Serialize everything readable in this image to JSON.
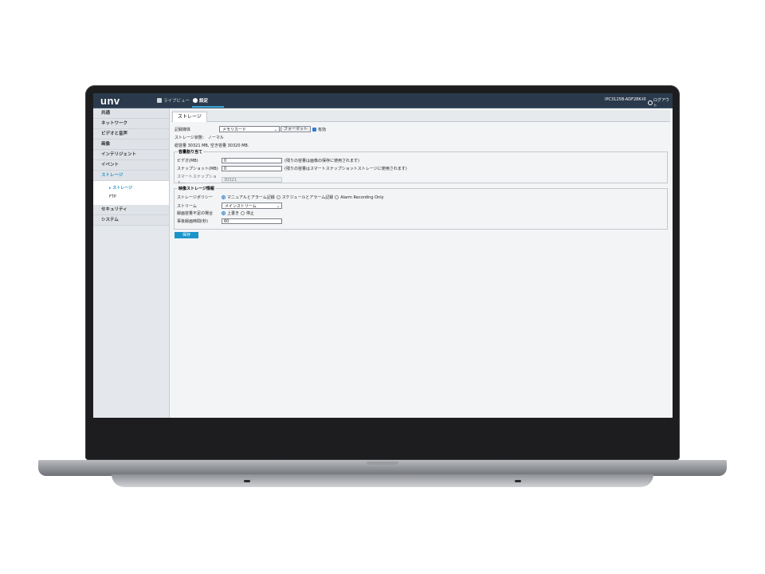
{
  "app": {
    "logo": "unv",
    "nav": [
      {
        "label": "ライブビュー",
        "icon": "camera-icon"
      },
      {
        "label": "設定",
        "icon": "gear-icon"
      }
    ],
    "device": "IPC3125B-ADF28K-I0",
    "logout": "ログアウト"
  },
  "sidebar": {
    "items": [
      {
        "label": "共通"
      },
      {
        "label": "ネットワーク"
      },
      {
        "label": "ビデオと音声"
      },
      {
        "label": "画像"
      },
      {
        "label": "インテリジェント"
      },
      {
        "label": "イベント"
      },
      {
        "label": "ストレージ"
      },
      {
        "label": "セキュリティ"
      },
      {
        "label": "システム"
      }
    ],
    "sub": [
      {
        "label": "ストレージ"
      },
      {
        "label": "FTP"
      }
    ]
  },
  "tab": "ストレージ",
  "storage": {
    "medium_label": "記録媒体",
    "medium_value": "メモリカード",
    "format_button": "フォーマット",
    "enable_label": "有効",
    "status_label": "ストレージ状態：",
    "status_value": "ノーマル",
    "capacity": "総容量 30321 MB, 空き容量 30320 MB."
  },
  "allocation": {
    "legend": "容量割り当て",
    "video_label": "ビデオ(MB)",
    "video_value": "0",
    "video_note": "(残りの容量は画像の保存に使用されます)",
    "snapshot_label": "スナップショット(MB)",
    "snapshot_value": "0",
    "snapshot_note": "(残りの容量はスマートスナップショットストレージに使用されます)",
    "smart_label": "スマートスナップショッ…",
    "smart_value": "30321"
  },
  "recording": {
    "legend": "映像ストレージ情報",
    "policy_label": "ストレージポリシー",
    "policy_options": [
      "マニュアルとアラーム記録",
      "スケジュールとアラーム記録",
      "Alarm Recording Only"
    ],
    "stream_label": "ストリーム",
    "stream_value": "メインストリーム",
    "full_label": "録画容量不足の場合",
    "full_options": [
      "上書き",
      "停止"
    ],
    "prerecord_label": "事後録画時間(秒)",
    "prerecord_value": "60"
  },
  "save_button": "保存"
}
